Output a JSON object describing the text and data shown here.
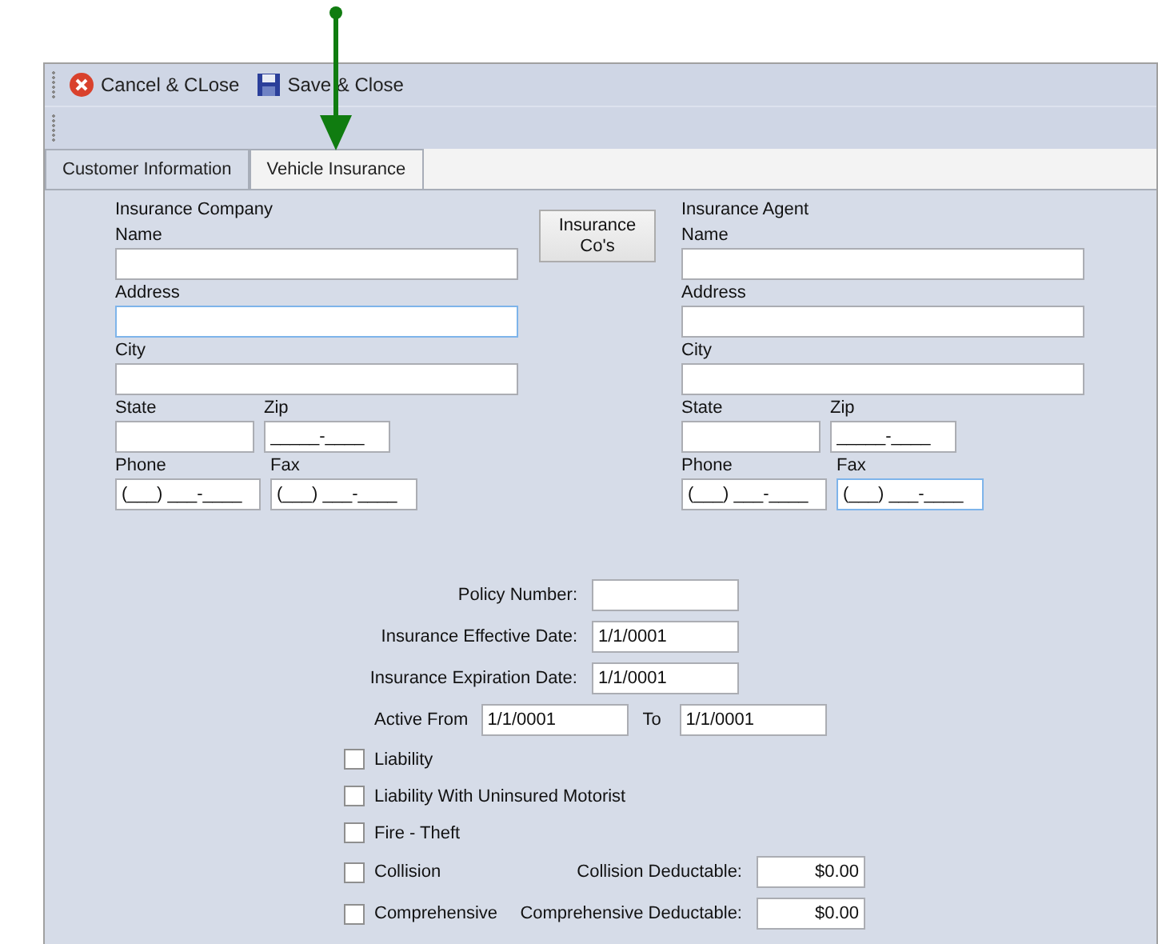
{
  "toolbar": [
    {
      "kind": "cancel",
      "label": "Cancel & CLose"
    },
    {
      "kind": "save",
      "label": "Save & Close"
    }
  ],
  "tabs": [
    {
      "label": "Customer Information",
      "selected": false
    },
    {
      "label": "Vehicle Insurance",
      "selected": true
    }
  ],
  "groups": [
    {
      "title": "Insurance Company",
      "name": {
        "label": "Name",
        "focused": false
      },
      "address": {
        "label": "Address",
        "focused": true
      },
      "city": {
        "label": "City",
        "focused": false
      },
      "state": {
        "label": "State",
        "focused": false
      },
      "zip": {
        "label": "Zip",
        "value": "_____-____",
        "focused": false
      },
      "phone": {
        "label": "Phone",
        "value": "(___) ___-____",
        "focused": false
      },
      "fax": {
        "label": "Fax",
        "value": "(___) ___-____",
        "focused": false
      }
    },
    {
      "title": "Insurance Agent",
      "name": {
        "label": "Name",
        "focused": false
      },
      "address": {
        "label": "Address",
        "focused": false
      },
      "city": {
        "label": "City",
        "focused": false
      },
      "state": {
        "label": "State",
        "focused": false
      },
      "zip": {
        "label": "Zip",
        "value": "_____-____",
        "focused": false
      },
      "phone": {
        "label": "Phone",
        "value": "(___) ___-____",
        "focused": false
      },
      "fax": {
        "label": "Fax",
        "value": "(___) ___-____",
        "focused": true
      }
    }
  ],
  "companies_button": "Insurance Co's",
  "policy_fields": [
    {
      "label": "Policy Number:"
    },
    {
      "label": "Insurance Effective Date:",
      "value": "1/1/0001"
    },
    {
      "label": "Insurance Expiration Date:",
      "value": "1/1/0001"
    }
  ],
  "active": {
    "label": "Active From",
    "from": "1/1/0001",
    "to_label": "To",
    "to": "1/1/0001"
  },
  "coverages": [
    {
      "label": "Liability",
      "checked": false
    },
    {
      "label": "Liability With Uninsured Motorist",
      "checked": false
    },
    {
      "label": "Fire - Theft",
      "checked": false
    },
    {
      "label": "Collision",
      "checked": false,
      "deductible": {
        "label": "Collision Deductable:",
        "value": "$0.00"
      }
    },
    {
      "label": "Comprehensive",
      "checked": false,
      "deductible": {
        "label": "Comprehensive Deductable:",
        "value": "$0.00"
      }
    }
  ]
}
